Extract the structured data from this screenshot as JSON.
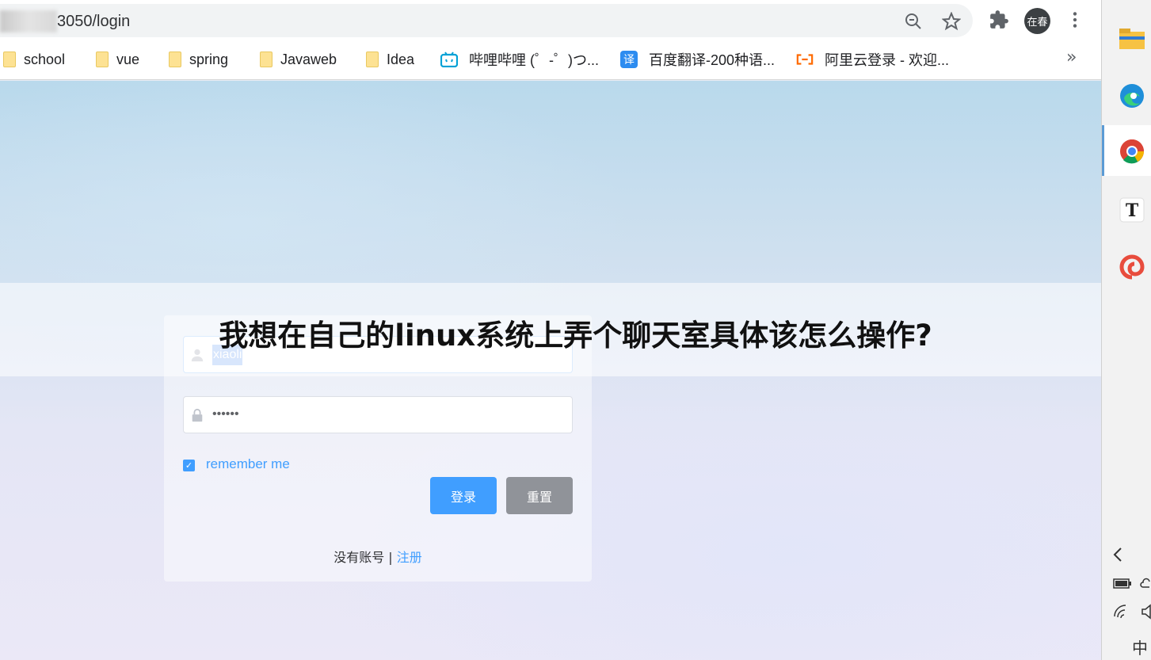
{
  "browser": {
    "url": "3050/login",
    "profile_initials": "在春",
    "bookmarks": [
      {
        "label": "school",
        "icon": "folder-icon"
      },
      {
        "label": "vue",
        "icon": "folder-icon"
      },
      {
        "label": "spring",
        "icon": "folder-icon"
      },
      {
        "label": "Javaweb",
        "icon": "folder-icon"
      },
      {
        "label": "Idea",
        "icon": "folder-icon"
      },
      {
        "label": "哔哩哔哩 (゜-゜)つ...",
        "icon": "bilibili-icon"
      },
      {
        "label": "百度翻译-200种语...",
        "icon": "baidu-translate-icon",
        "icon_text": "译"
      },
      {
        "label": "阿里云登录 - 欢迎...",
        "icon": "aliyun-icon"
      }
    ],
    "more_label": "»"
  },
  "login": {
    "username_value": "xiaoli",
    "password_value": "••••••",
    "remember_label": "remember me",
    "login_button": "登录",
    "reset_button": "重置",
    "no_account_text": "没有账号 | ",
    "register_link": "注册"
  },
  "banner": {
    "title": "我想在自己的linux系统上弄个聊天室具体该怎么操作?"
  },
  "taskbar": {
    "ime_label": "中"
  },
  "colors": {
    "primary": "#409eff",
    "secondary": "#909399"
  }
}
